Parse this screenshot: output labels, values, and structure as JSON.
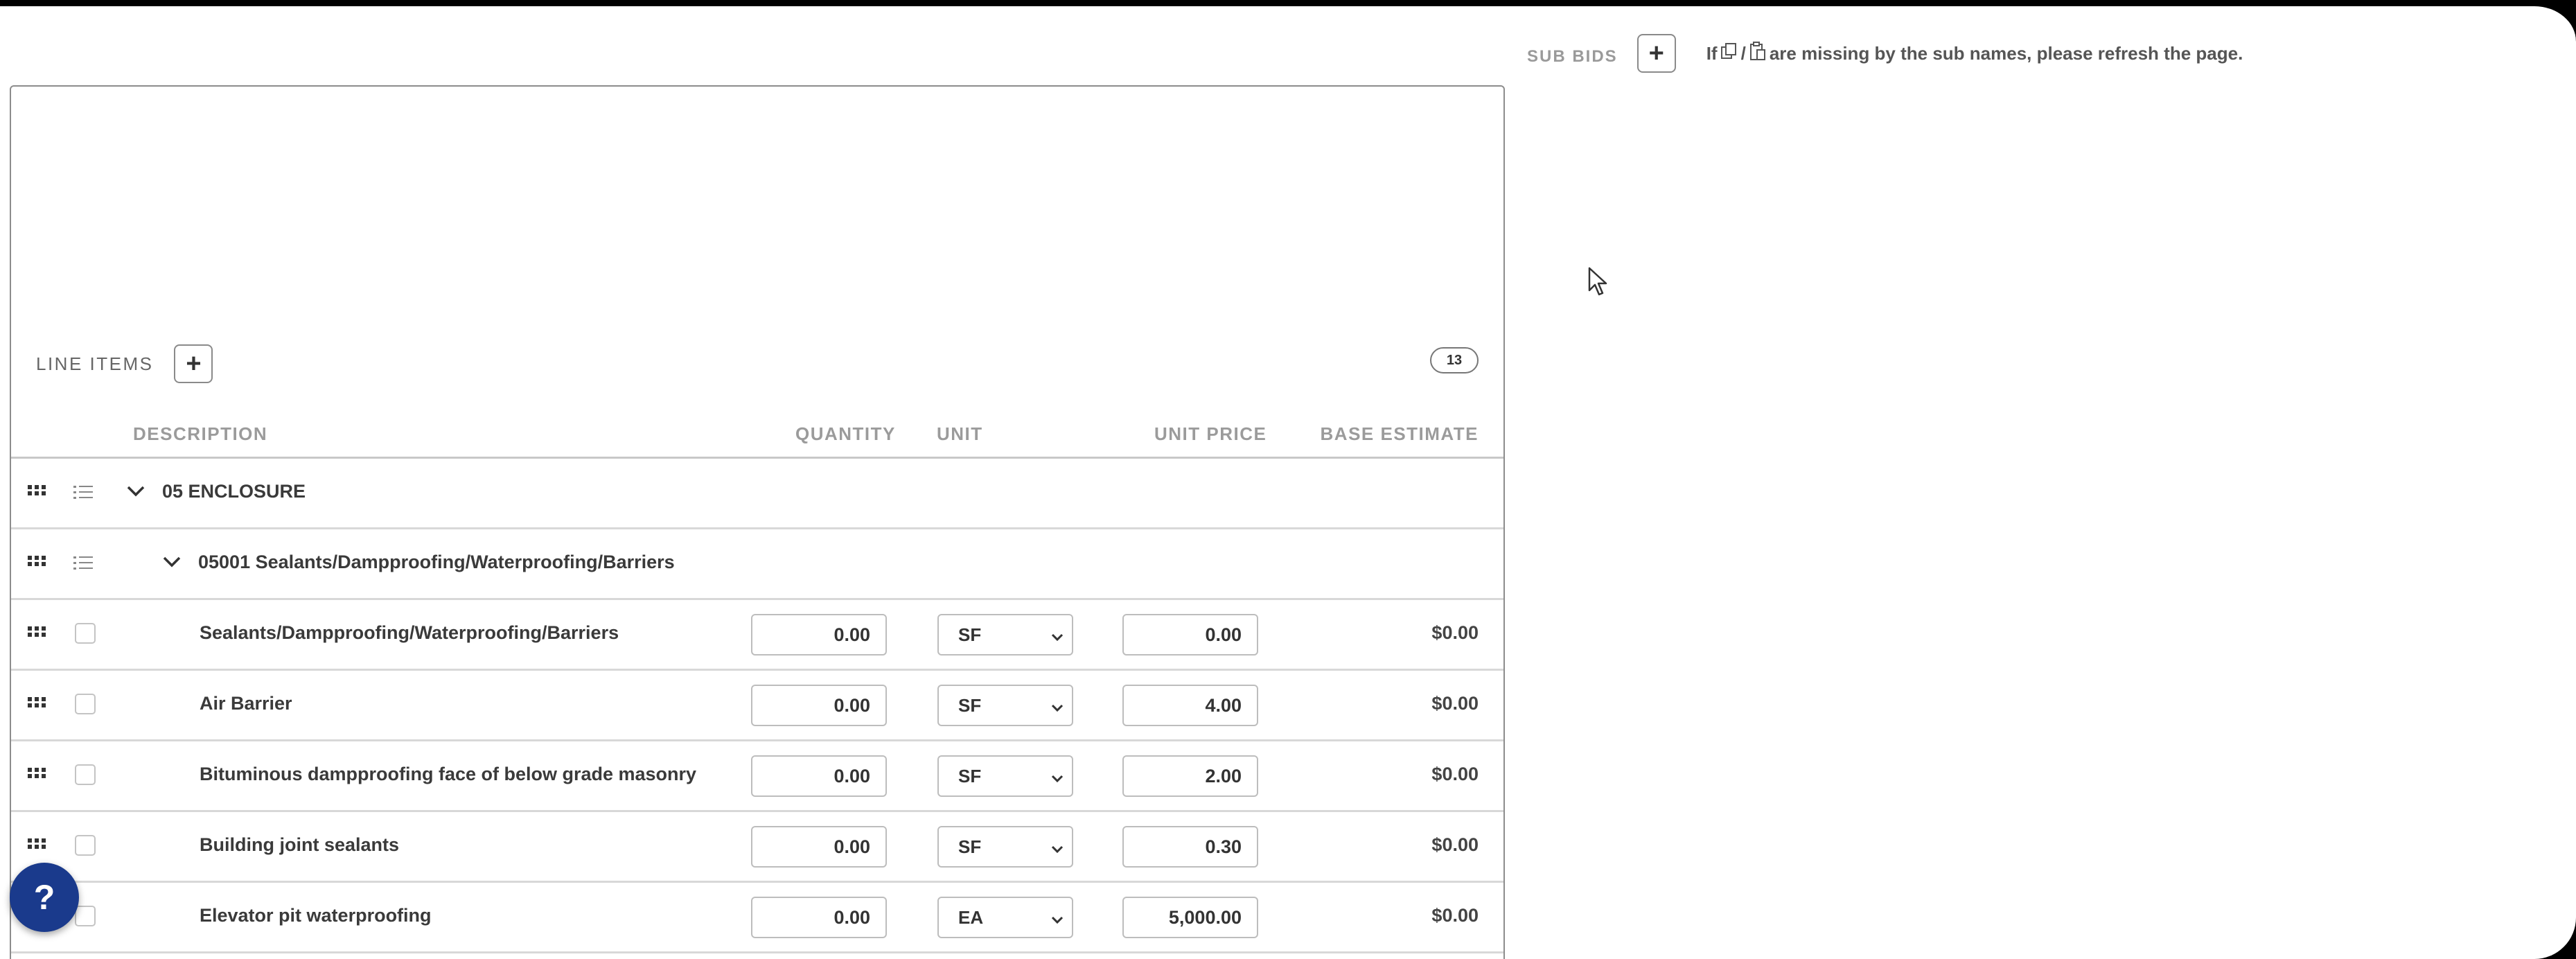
{
  "sub_bids": {
    "label": "SUB BIDS",
    "note_prefix": "If",
    "note_sep": "/",
    "note_suffix": "are missing by the sub names, please refresh the page."
  },
  "line_items": {
    "title": "LINE ITEMS",
    "count": "13",
    "columns": {
      "description": "DESCRIPTION",
      "quantity": "QUANTITY",
      "unit": "UNIT",
      "unit_price": "UNIT PRICE",
      "base_estimate": "BASE ESTIMATE"
    },
    "groups": [
      {
        "label": "05 ENCLOSURE"
      },
      {
        "label": "05001 Sealants/Dampproofing/Waterproofing/Barriers"
      }
    ],
    "rows": [
      {
        "description": "Sealants/Dampproofing/Waterproofing/Barriers",
        "quantity": "0.00",
        "unit": "SF",
        "unit_price": "0.00",
        "base_estimate": "$0.00"
      },
      {
        "description": "Air Barrier",
        "quantity": "0.00",
        "unit": "SF",
        "unit_price": "4.00",
        "base_estimate": "$0.00"
      },
      {
        "description": "Bituminous dampproofing face of below grade masonry",
        "quantity": "0.00",
        "unit": "SF",
        "unit_price": "2.00",
        "base_estimate": "$0.00"
      },
      {
        "description": "Building joint sealants",
        "quantity": "0.00",
        "unit": "SF",
        "unit_price": "0.30",
        "base_estimate": "$0.00"
      },
      {
        "description": "Elevator pit waterproofing",
        "quantity": "0.00",
        "unit": "EA",
        "unit_price": "5,000.00",
        "base_estimate": "$0.00"
      }
    ]
  },
  "help": {
    "label": "?"
  },
  "colors": {
    "help_bg": "#1a3a8c",
    "border": "#8c8c8c",
    "muted": "#9b9b9b"
  }
}
